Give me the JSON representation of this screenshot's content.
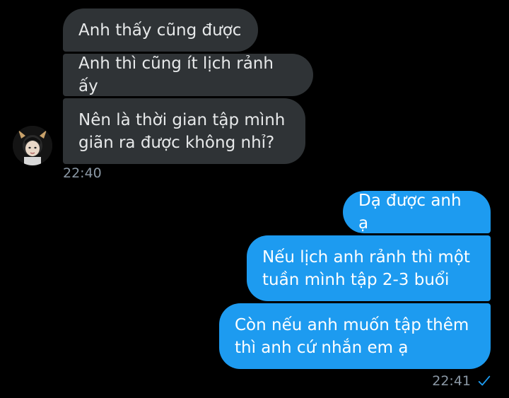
{
  "conversation": {
    "incoming": [
      {
        "text": "Anh thấy cũng được"
      },
      {
        "text": "Anh thì cũng ít lịch rảnh ấy"
      },
      {
        "text": "Nên là thời gian tập mình\ngiãn ra được không nhỉ?"
      }
    ],
    "incoming_time": "22:40",
    "outgoing": [
      {
        "text": "Dạ được anh ạ"
      },
      {
        "text": "Nếu lịch anh rảnh thì một\ntuần mình tập 2-3 buổi"
      },
      {
        "text": "Còn nếu anh muốn tập thêm\nthì anh cứ nhắn em ạ"
      }
    ],
    "outgoing_time": "22:41",
    "outgoing_status_icon": "checkmark-icon"
  },
  "colors": {
    "background": "#000000",
    "incoming_bubble": "#2f3336",
    "outgoing_bubble": "#1d9bf0",
    "timestamp": "#8b98a5"
  }
}
